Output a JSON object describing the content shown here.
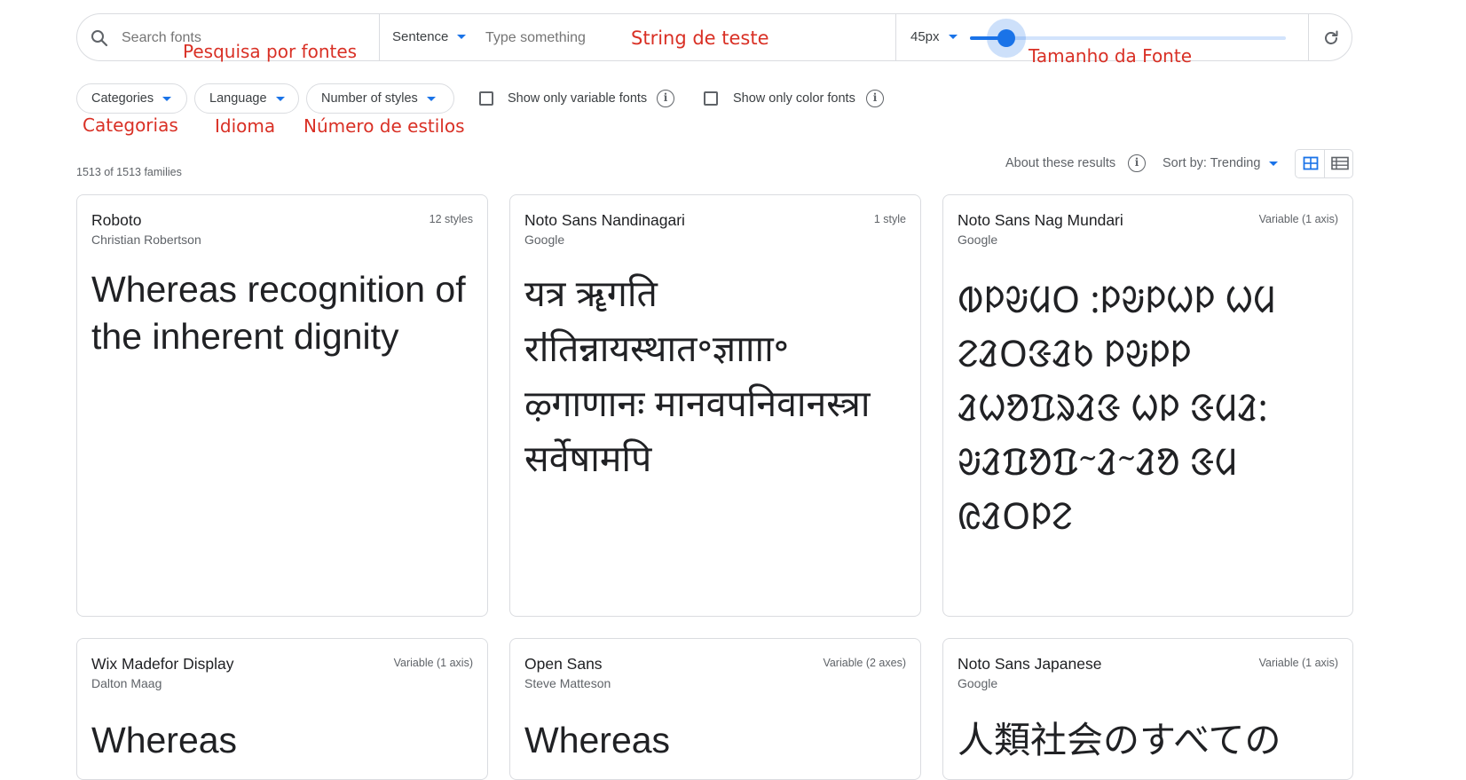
{
  "search": {
    "placeholder": "Search fonts",
    "preview_mode": "Sentence",
    "preview_placeholder": "Type something",
    "size_value": "45px",
    "slider_fraction": 0.06
  },
  "annotations": {
    "search": "Pesquisa por fontes",
    "test_string": "String de teste",
    "font_size": "Tamanho da Fonte",
    "categories": "Categorias",
    "language": "Idioma",
    "styles": "Número de estilos"
  },
  "filters": {
    "categories": "Categories",
    "language": "Language",
    "styles": "Number of styles",
    "variable": "Show only variable fonts",
    "color": "Show only color fonts"
  },
  "results": {
    "count": "1513 of 1513 families",
    "about": "About these results",
    "sort": "Sort by: Trending"
  },
  "cards": [
    {
      "name": "Roboto",
      "author": "Christian Robertson",
      "styles": "12 styles",
      "sample": "Whereas recognition of the inherent dignity"
    },
    {
      "name": "Noto Sans Nandinagari",
      "author": "Google",
      "styles": "1 style",
      "sample": "यत्र ॠगति राऺतिन्नायस्थात॰ज्ञाााा॰ ऴ्गाणानः मानवपनिवानस्त्रा सर्वेषामपि"
    },
    {
      "name": "Noto Sans Nag Mundari",
      "author": "Google",
      "styles": "Variable (1 axis)",
      "sample": "ᱵᱞᱶᱢᱛ ᱺᱞᱶᱞᱦᱞ ᱦᱢ ᱮᱲᱛᱝᱲᱠ ᱞᱶᱞᱞ ᱲᱦᱚᱯᱨᱲᱝ ᱦᱞ ᱝᱢᱲᱺ ᱶᱲᱯᱚᱯᱻᱲᱻᱲᱚ ᱝᱢ ᱭᱲᱛᱞᱮ"
    },
    {
      "name": "Wix Madefor Display",
      "author": "Dalton Maag",
      "styles": "Variable (1 axis)",
      "sample": "Whereas"
    },
    {
      "name": "Open Sans",
      "author": "Steve Matteson",
      "styles": "Variable (2 axes)",
      "sample": "Whereas"
    },
    {
      "name": "Noto Sans Japanese",
      "author": "Google",
      "styles": "Variable (1 axis)",
      "sample": "人類社会のすべての"
    }
  ],
  "colors": {
    "accent": "#1a73e8",
    "annotation": "#d93025",
    "border": "#dadce0"
  },
  "icons": [
    "search-icon",
    "chevron-down-icon",
    "refresh-icon",
    "info-icon",
    "grid-view-icon",
    "list-view-icon"
  ]
}
